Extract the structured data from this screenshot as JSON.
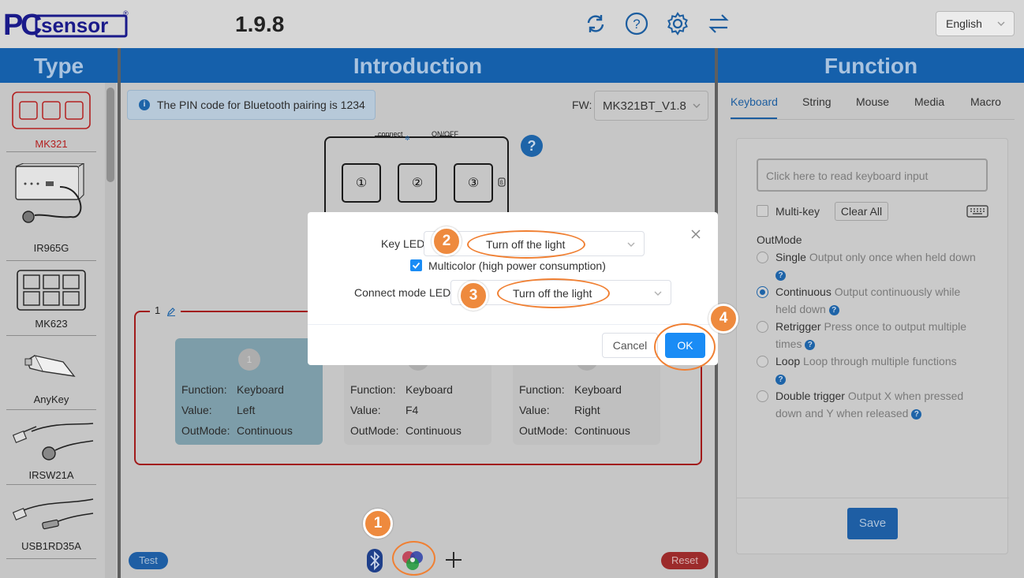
{
  "app": {
    "logo_text": "PCsensor",
    "version": "1.9.8",
    "language": "English"
  },
  "toolbar_icons": [
    "refresh-icon",
    "help-icon",
    "settings-icon",
    "swap-icon"
  ],
  "columns": {
    "type": "Type",
    "introduction": "Introduction",
    "function": "Function"
  },
  "type_list": [
    {
      "label": "MK321",
      "selected": true
    },
    {
      "label": "IR965G"
    },
    {
      "label": "MK623"
    },
    {
      "label": "AnyKey"
    },
    {
      "label": "IRSW21A"
    },
    {
      "label": "USB1RD35A"
    }
  ],
  "intro": {
    "pin_notice": "The PIN code for Bluetooth pairing is 1234",
    "fw_label": "FW:",
    "fw_value": "MK321BT_V1.8",
    "device_connect": "connect",
    "device_onoff": "ON/OFF",
    "device_keys": [
      "①",
      "②",
      "③"
    ],
    "group_label": "1",
    "key_cards": [
      {
        "num": "1",
        "function": "Keyboard",
        "value": "Left",
        "outmode": "Continuous"
      },
      {
        "num": "2",
        "function": "Keyboard",
        "value": "F4",
        "outmode": "Continuous"
      },
      {
        "num": "3",
        "function": "Keyboard",
        "value": "Right",
        "outmode": "Continuous"
      }
    ],
    "field_labels": {
      "function": "Function:",
      "value": "Value:",
      "outmode": "OutMode:"
    },
    "test_label": "Test",
    "reset_label": "Reset"
  },
  "function": {
    "tabs": [
      "Keyboard",
      "String",
      "Mouse",
      "Media",
      "Macro"
    ],
    "active_tab": "Keyboard",
    "read_placeholder": "Click here to read keyboard input",
    "multikey_label": "Multi-key",
    "clear_all_label": "Clear All",
    "outmode_title": "OutMode",
    "modes": [
      {
        "name": "Single",
        "desc": "Output only once when held down",
        "checked": false
      },
      {
        "name": "Continuous",
        "desc": "Output continuously while held down",
        "checked": true
      },
      {
        "name": "Retrigger",
        "desc": "Press once to output multiple times",
        "checked": false
      },
      {
        "name": "Loop",
        "desc": "Loop through multiple functions",
        "checked": false
      },
      {
        "name": "Double trigger",
        "desc": "Output X when pressed down and Y when released",
        "checked": false
      }
    ],
    "save_label": "Save"
  },
  "modal": {
    "key_led_label": "Key LED",
    "key_led_value": "Turn off the light",
    "multicolor_label": "Multicolor (high power consumption)",
    "multicolor_checked": true,
    "connect_led_label": "Connect mode LED",
    "connect_led_value": "Turn off the light",
    "cancel_label": "Cancel",
    "ok_label": "OK"
  },
  "annotations": [
    "1",
    "2",
    "3",
    "4"
  ],
  "colors": {
    "header_blue": "#1560ab",
    "primary_blue": "#1a8cf5",
    "annotation_orange": "#ee8a3e",
    "selected_red": "#a11a1a"
  }
}
